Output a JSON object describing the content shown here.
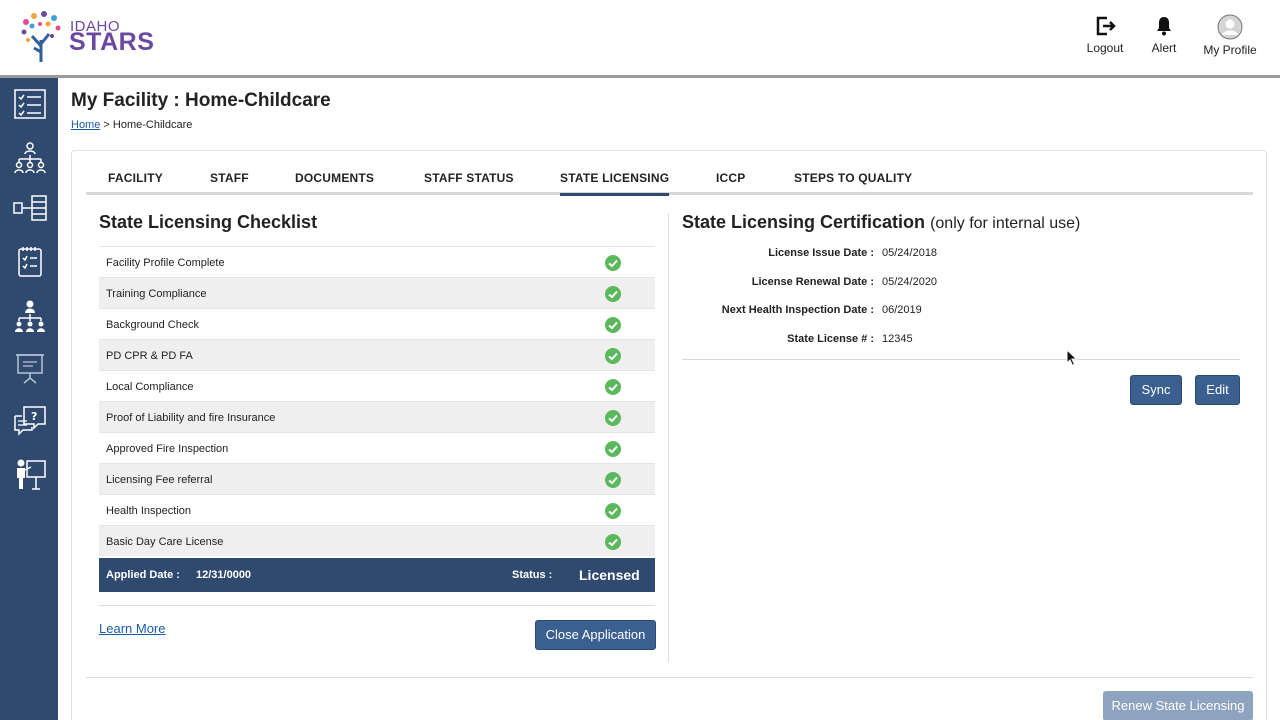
{
  "brand": {
    "line1": "IDAHO",
    "line2": "STARS",
    "logo_icon": "tree-logo-icon"
  },
  "header": {
    "logout": "Logout",
    "alert": "Alert",
    "profile": "My Profile"
  },
  "sidebar": {
    "items": [
      {
        "icon": "checklist-icon"
      },
      {
        "icon": "org-chart-icon"
      },
      {
        "icon": "data-flow-icon"
      },
      {
        "icon": "calendar-checklist-icon"
      },
      {
        "icon": "hierarchy-icon"
      },
      {
        "icon": "presentation-board-icon"
      },
      {
        "icon": "help-chat-icon"
      },
      {
        "icon": "teacher-icon"
      }
    ]
  },
  "page": {
    "title": "My Facility : Home-Childcare",
    "breadcrumb_home": "Home",
    "breadcrumb_sep": " > ",
    "breadcrumb_current": "Home-Childcare"
  },
  "tabs": [
    "FACILITY",
    "STAFF",
    "DOCUMENTS",
    "STAFF STATUS",
    "STATE LICENSING",
    "ICCP",
    "STEPS TO QUALITY"
  ],
  "active_tab": "STATE LICENSING",
  "checklist": {
    "title": "State Licensing Checklist",
    "items": [
      "Facility Profile Complete",
      "Training Compliance",
      "Background Check",
      "PD CPR & PD FA",
      "Local Compliance",
      "Proof of Liability and fire Insurance",
      "Approved Fire Inspection",
      "Licensing Fee referral",
      "Health Inspection",
      "Basic Day Care License"
    ],
    "check_color": "#5cb85c",
    "applied_label": "Applied Date :",
    "applied_value": "12/31/0000",
    "status_label": "Status :",
    "status_value": "Licensed",
    "learn_more": "Learn More",
    "close_button": "Close Application"
  },
  "certification": {
    "title": "State Licensing Certification",
    "subtitle": "(only for internal use)",
    "fields": [
      {
        "label": "License Issue Date :",
        "value": "05/24/2018"
      },
      {
        "label": "License Renewal Date :",
        "value": "05/24/2020"
      },
      {
        "label": "Next Health Inspection Date :",
        "value": "06/2019"
      },
      {
        "label": "State License # :",
        "value": "12345"
      }
    ],
    "sync_button": "Sync",
    "edit_button": "Edit"
  },
  "footer": {
    "renew_button": "Renew State Licensing"
  },
  "colors": {
    "sidebar": "#2f4a6e",
    "accent": "#3b5f8f",
    "brand": "#6b4a9e"
  }
}
